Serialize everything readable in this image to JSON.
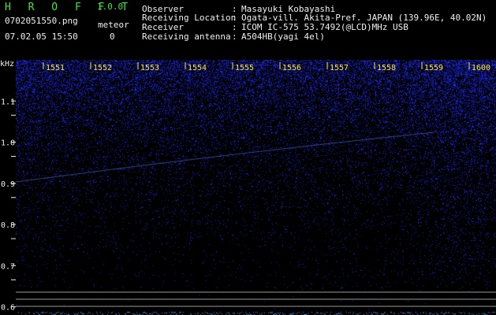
{
  "app": {
    "brand": "H R O F F T",
    "version": "1.0.0",
    "filename": "0702051550.png",
    "datetime": "07.02.05 15:50",
    "meteor_label": "meteor",
    "meteor_count": "0"
  },
  "info": [
    {
      "label": "Observer",
      "sep": ":",
      "value": "Masayuki Kobayashi"
    },
    {
      "label": "Receiving Location",
      "sep": ":",
      "value": "Ogata-vill. Akita-Pref. JAPAN (139.96E, 40.02N)"
    },
    {
      "label": "Receiver",
      "sep": ":",
      "value": "ICOM IC-575 53.7492(@LCD)MHz USB"
    },
    {
      "label": "Receiving antenna",
      "sep": ":",
      "value": "A504HB(yagi 4el)"
    }
  ],
  "axis": {
    "unit": "kHz",
    "y_ticks": [
      "1.1",
      "1.0",
      "0.9",
      "0.8",
      "0.7",
      "0.6"
    ],
    "y_values": [
      1.1,
      1.0,
      0.9,
      0.8,
      0.7,
      0.6
    ],
    "y_range": [
      0.58,
      1.2
    ],
    "x_ticks": [
      "1551",
      "1552",
      "1553",
      "1554",
      "1555",
      "1556",
      "1557",
      "1558",
      "1559",
      "1600"
    ]
  },
  "colors": {
    "background": "#000000",
    "noise_blue": "#1a2cff",
    "brand_green": "#3ee63e",
    "x_label_yellow": "#ffe83a",
    "text_white": "#f0f0f0",
    "trace_blue": "#5f7aff"
  }
}
